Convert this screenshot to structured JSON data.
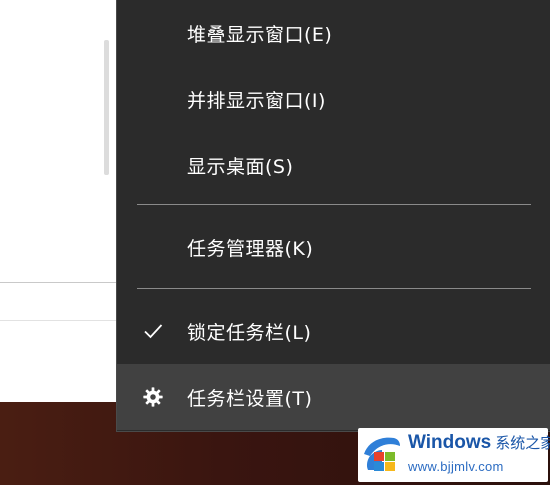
{
  "context_menu": {
    "items": [
      {
        "label": "堆叠显示窗口(E)"
      },
      {
        "label": "并排显示窗口(I)"
      },
      {
        "label": "显示桌面(S)"
      },
      {
        "label": "任务管理器(K)"
      },
      {
        "label": "锁定任务栏(L)",
        "checked": true,
        "icon": "checkmark-icon"
      },
      {
        "label": "任务栏设置(T)",
        "icon": "gear-icon",
        "highlighted": true
      }
    ]
  },
  "watermark": {
    "brand": "Windows",
    "brand_cn": "系统之家",
    "url": "www.bjjmlv.com"
  },
  "colors": {
    "menu_bg": "#2b2b2b",
    "menu_hover": "#414141",
    "separator": "#8a8a8a",
    "text": "#ffffff",
    "watermark_blue": "#1a56a8"
  }
}
